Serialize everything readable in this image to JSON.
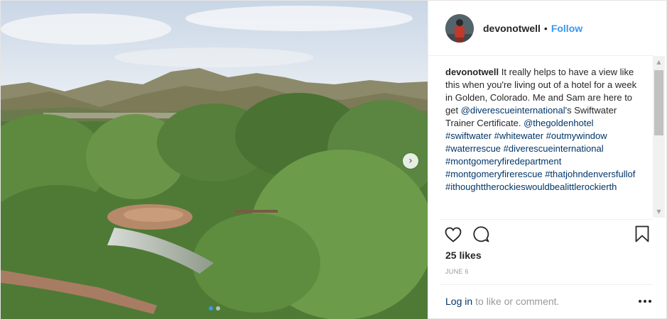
{
  "post": {
    "username": "devonotwell",
    "separator": "•",
    "follow_label": "Follow",
    "caption": {
      "username": "devonotwell",
      "text": "It really helps to have a view like this when you're living out of a hotel for a week in Golden, Colorado. Me and Sam are here to get ",
      "mention1": "@diverescueinternational",
      "text2": "'s Swiftwater Trainer Certificate. ",
      "mention2": "@thegoldenhotel",
      "hashtags": [
        "#swiftwater",
        "#whitewater",
        "#outmywindow",
        "#waterrescue",
        "#diverescueinternational",
        "#montgomeryfiredepartment",
        "#montgomeryfirerescue",
        "#thatjohndenversfullof",
        "#ithoughttherockieswouldbealittlerockierth"
      ]
    },
    "likes": "25 likes",
    "date": "JUNE 6",
    "footer": {
      "login_label": "Log in",
      "rest_text": "to like or comment."
    },
    "carousel": {
      "next_glyph": "›",
      "slide_count": 2,
      "active_index": 0
    }
  },
  "icons": {
    "like": "heart-icon",
    "comment": "comment-icon",
    "save": "bookmark-icon",
    "more": "more-options-icon",
    "next": "chevron-right-icon"
  },
  "colors": {
    "link_blue": "#003569",
    "follow_blue": "#3897f0",
    "text": "#262626",
    "muted": "#999999"
  }
}
